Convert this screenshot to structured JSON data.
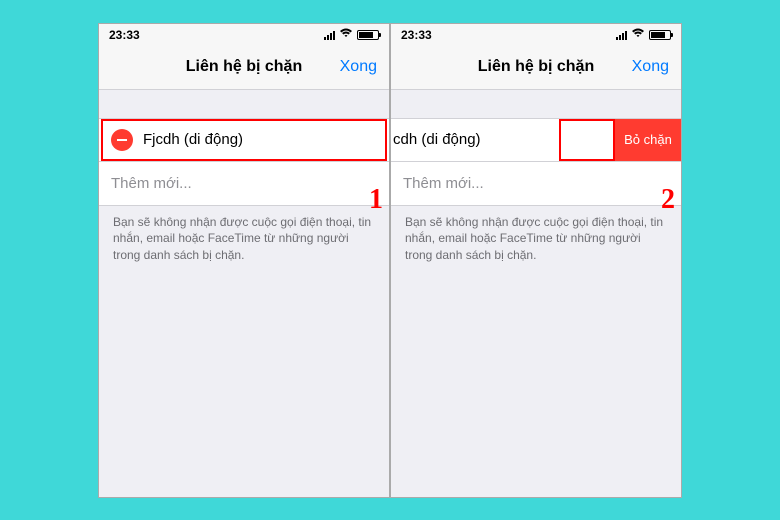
{
  "statusBar": {
    "time": "23:33"
  },
  "nav": {
    "title": "Liên hệ bị chặn",
    "done": "Xong"
  },
  "contact": {
    "name": "Fjcdh (di động)",
    "nameSwiped": "cdh (di động)"
  },
  "addNew": "Thêm mới...",
  "unblock": "Bỏ chặn",
  "footer": "Bạn sẽ không nhận được cuộc gọi điện thoại, tin nhắn, email hoặc FaceTime từ những người trong danh sách bị chặn.",
  "steps": {
    "one": "1",
    "two": "2"
  }
}
